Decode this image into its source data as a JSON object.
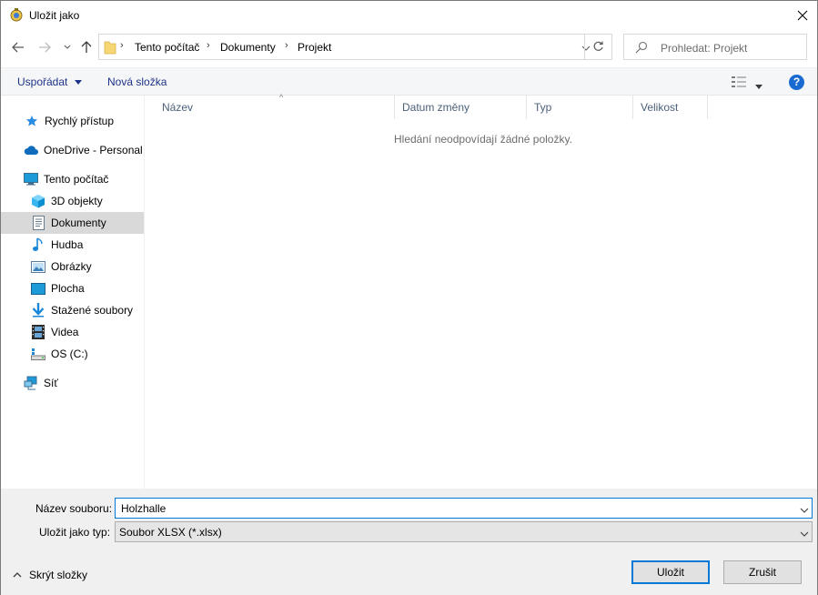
{
  "window": {
    "title": "Uložit jako"
  },
  "address": {
    "crumbs": [
      "Tento počítač",
      "Dokumenty",
      "Projekt"
    ]
  },
  "search": {
    "placeholder": "Prohledat: Projekt"
  },
  "toolbar": {
    "organize_label": "Uspořádat",
    "new_folder_label": "Nová složka",
    "help_label": "?"
  },
  "nav": {
    "items": [
      {
        "label": "Rychlý přístup",
        "icon": "star-icon"
      },
      {
        "label": "OneDrive - Personal",
        "icon": "cloud-icon"
      },
      {
        "label": "Tento počítač",
        "icon": "computer-icon"
      },
      {
        "label": "3D objekty",
        "icon": "cube-icon"
      },
      {
        "label": "Dokumenty",
        "icon": "document-icon",
        "selected": true
      },
      {
        "label": "Hudba",
        "icon": "music-icon"
      },
      {
        "label": "Obrázky",
        "icon": "picture-icon"
      },
      {
        "label": "Plocha",
        "icon": "desktop-icon"
      },
      {
        "label": "Stažené soubory",
        "icon": "download-icon"
      },
      {
        "label": "Videa",
        "icon": "film-icon"
      },
      {
        "label": "OS (C:)",
        "icon": "drive-icon"
      },
      {
        "label": "Síť",
        "icon": "network-icon"
      }
    ]
  },
  "columns": [
    "Název",
    "Datum změny",
    "Typ",
    "Velikost"
  ],
  "empty_message": "Hledání neodpovídají žádné položky.",
  "form": {
    "filename_label": "Název souboru:",
    "filename_value": "Holzhalle",
    "filetype_label": "Uložit jako typ:",
    "filetype_value": "Soubor XLSX (*.xlsx)"
  },
  "footer": {
    "hide_folders_label": "Skrýt složky",
    "save_label": "Uložit",
    "cancel_label": "Zrušit"
  },
  "colors": {
    "accent": "#0078d7",
    "selected_bg": "#d9d9d9",
    "link": "#1e3287"
  }
}
